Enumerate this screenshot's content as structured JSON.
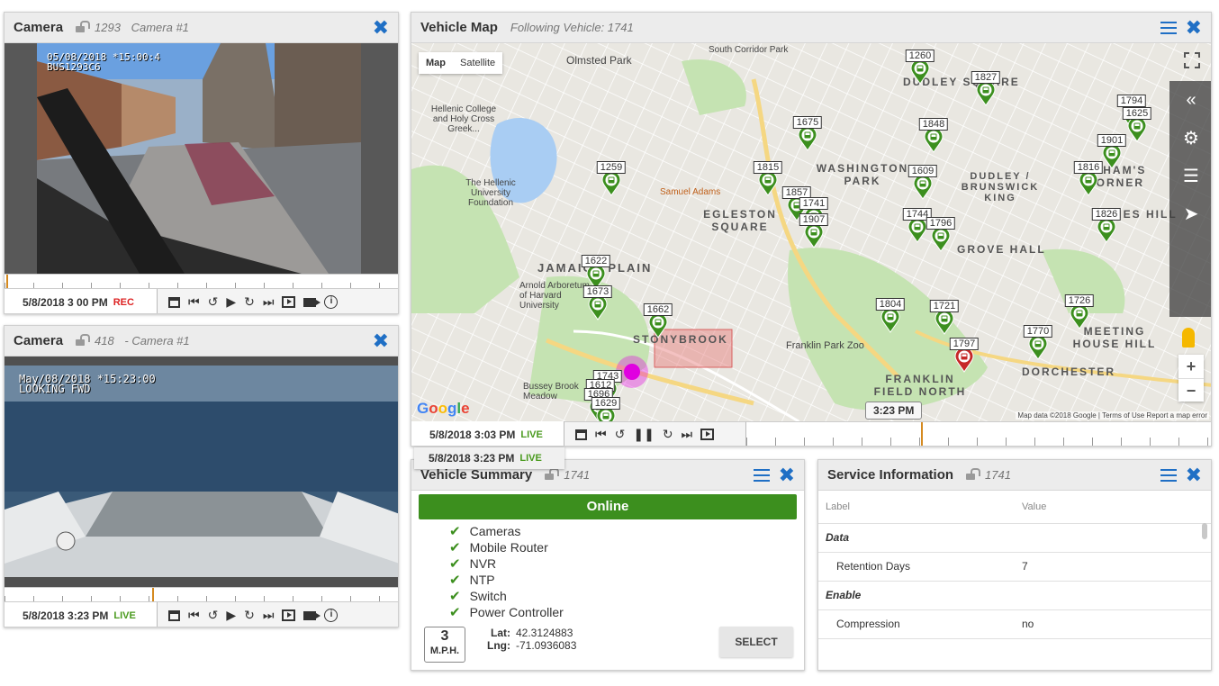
{
  "camera1": {
    "title": "Camera",
    "sub_id": "1293",
    "sub_name": "Camera #1",
    "overlay_line1": "05/08/2018 *15:00:4",
    "overlay_line2": "BUS1293C6",
    "time": "5/8/2018  3 00 PM",
    "status": "REC",
    "timeline_cursor_pct": 0.5
  },
  "camera2": {
    "title": "Camera",
    "sub_id": "418",
    "sub_name": "- Camera #1",
    "overlay_line1": "May/08/2018 *15:23:00",
    "overlay_line2": "LOOKING FWD",
    "time": "5/8/2018  3:23 PM",
    "status": "LIVE",
    "timeline_cursor_pct": 37.5
  },
  "map": {
    "title": "Vehicle Map",
    "subtitle": "Following Vehicle: 1741",
    "map_btn": "Map",
    "satellite_btn": "Satellite",
    "time": "5/8/2018  3:03 PM",
    "status": "LIVE",
    "dropdown_time": "5/8/2018  3:23 PM",
    "dropdown_status": "LIVE",
    "time_bubble": "3:23 PM",
    "google": "Google",
    "attribution": "Map data ©2018 Google  |  Terms of Use   Report a map error",
    "timeline_cursor_pct": 44,
    "places": [
      "Olmsted Park",
      "Hellenic College and Holy Cross Greek...",
      "The Hellenic University Foundation",
      "Samuel Adams",
      "EGLESTON SQUARE",
      "JAMAICA PLAIN",
      "Arnold Arboretum of Harvard University",
      "STONYBROOK",
      "Franklin Park Zoo",
      "FRANKLIN FIELD NORTH",
      "WASHINGTON PARK",
      "DUDLEY SQUARE",
      "DUDLEY / BRUNSWICK KING",
      "UPHAM'S CORNER",
      "JONES HILL",
      "GROVE HALL",
      "MEETING HOUSE HILL",
      "DORCHESTER",
      "Bussey Brook Meadow",
      "South Corridor Park"
    ],
    "vehicles": [
      "1260",
      "1827",
      "1675",
      "1848",
      "1794",
      "1625",
      "1901",
      "1816",
      "1259",
      "1815",
      "1609",
      "1857",
      "1741",
      "1907",
      "1744",
      "1796",
      "1826",
      "1622",
      "1673",
      "1662",
      "1804",
      "1721",
      "1726",
      "1770",
      "1797",
      "1743",
      "1612",
      "1696",
      "1629"
    ],
    "colors": {
      "marker_green": "#3c8f1e",
      "marker_red": "#c62828",
      "water": "#a9cdf3",
      "park": "#c5e3b2",
      "road": "#ffffff"
    }
  },
  "summary": {
    "title": "Vehicle Summary",
    "sub_id": "1741",
    "status": "Online",
    "checks": [
      "Cameras",
      "Mobile Router",
      "NVR",
      "NTP",
      "Switch",
      "Power Controller"
    ],
    "speed": "3",
    "speed_unit": "M.P.H.",
    "lat_label": "Lat:",
    "lat": "42.3124883",
    "lng_label": "Lng:",
    "lng": "-71.0936083",
    "select_btn": "SELECT"
  },
  "service": {
    "title": "Service Information",
    "sub_id": "1741",
    "col_label": "Label",
    "col_value": "Value",
    "sections": [
      {
        "name": "Data",
        "rows": [
          {
            "label": "Retention Days",
            "value": "7"
          }
        ]
      },
      {
        "name": "Enable",
        "rows": [
          {
            "label": "Compression",
            "value": "no"
          }
        ]
      }
    ]
  }
}
